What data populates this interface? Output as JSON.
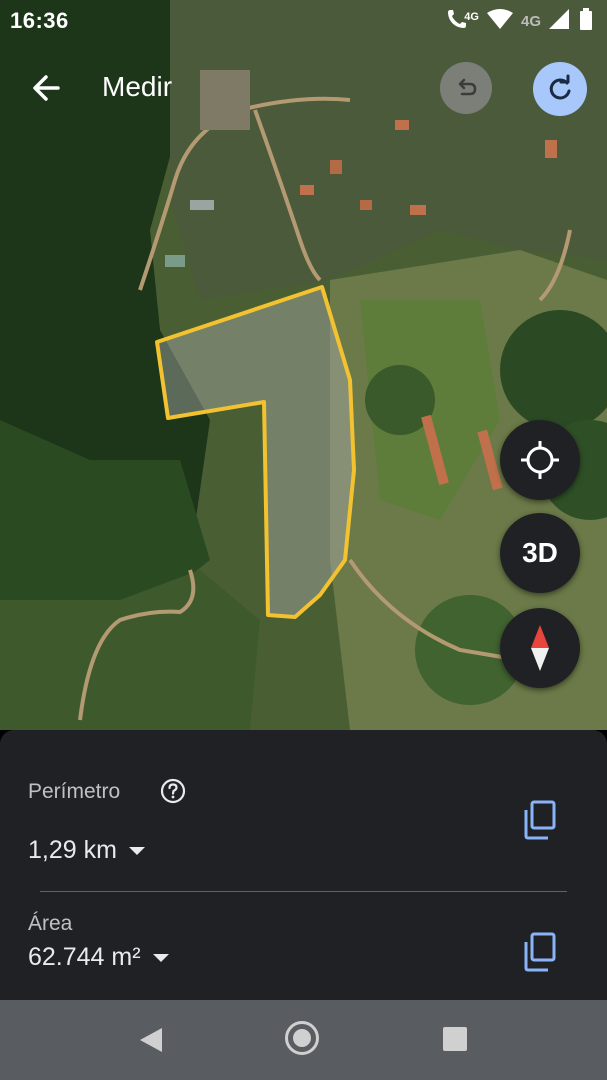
{
  "status_bar": {
    "time": "16:36",
    "network_1": "4G",
    "network_2": "4G",
    "icons": [
      "wifi-calling-icon",
      "wifi-icon",
      "signal-icon",
      "battery-icon"
    ]
  },
  "app_bar": {
    "title": "Medir",
    "back_icon": "arrow-left-icon",
    "undo_icon": "undo-icon",
    "redo_icon": "redo-icon"
  },
  "map_controls": {
    "target_icon": "my-location-icon",
    "three_d_label": "3D",
    "compass_icon": "compass-icon"
  },
  "measurement": {
    "perimeter_label": "Perímetro",
    "perimeter_value": "1,29 km",
    "area_label": "Área",
    "area_value": "62.744 m²"
  },
  "colors": {
    "polygon_stroke": "#f2c230",
    "sheet_bg": "#202124",
    "accent": "#a8c7fa",
    "copy_icon": "#8ab4f8"
  },
  "nav_bar": {
    "icons": [
      "nav-back-icon",
      "nav-home-icon",
      "nav-recents-icon"
    ]
  }
}
